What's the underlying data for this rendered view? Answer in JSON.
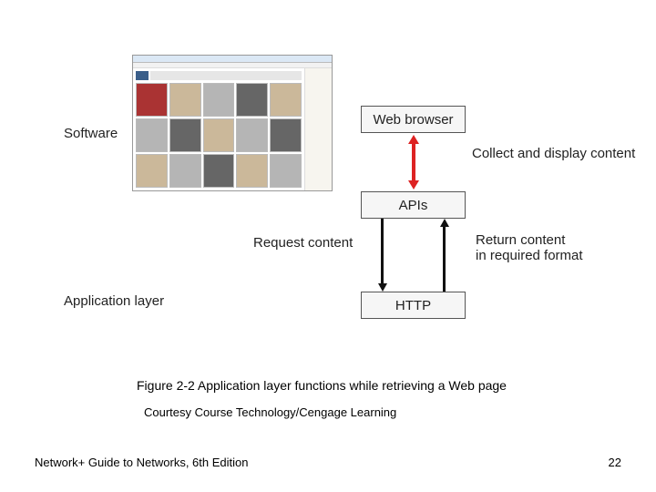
{
  "labels": {
    "software": "Software",
    "application_layer": "Application layer",
    "collect_display": "Collect and display content",
    "request_content": "Request content",
    "return_content_l1": "Return content",
    "return_content_l2": "in required format"
  },
  "boxes": {
    "web_browser": "Web browser",
    "apis": "APIs",
    "http": "HTTP"
  },
  "caption": "Figure 2-2 Application layer functions while retrieving a Web page",
  "credit": "Courtesy Course Technology/Cengage Learning",
  "footer_left": "Network+ Guide to Networks, 6th Edition",
  "page_number": "22"
}
